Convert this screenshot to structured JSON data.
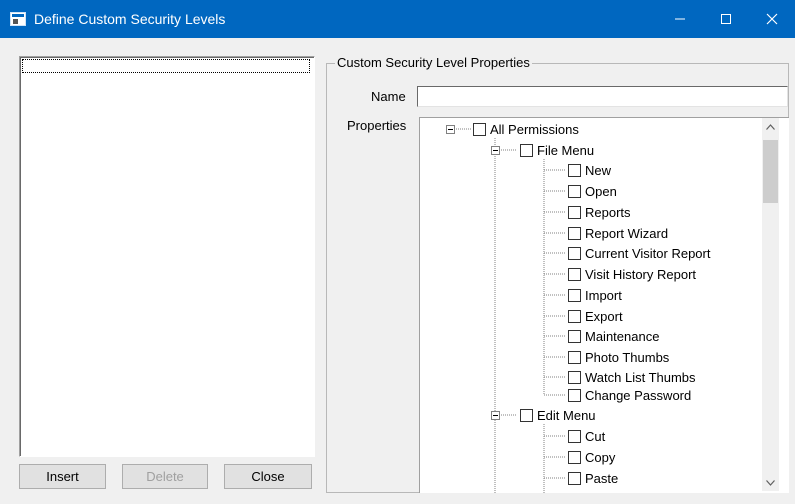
{
  "window": {
    "title": "Define Custom Security Levels"
  },
  "left_panel": {
    "buttons": {
      "insert": "Insert",
      "delete": "Delete",
      "close": "Close"
    }
  },
  "properties_group": {
    "label": "Custom Security Level Properties",
    "name_label": "Name",
    "name_value": "",
    "properties_label": "Properties"
  },
  "tree": {
    "root": "All Permissions",
    "file_menu": {
      "label": "File Menu",
      "items": [
        "New",
        "Open",
        "Reports",
        "Report Wizard",
        "Current Visitor Report",
        "Visit History Report",
        "Import",
        "Export",
        "Maintenance",
        "Photo Thumbs",
        "Watch List Thumbs",
        "Change Password"
      ]
    },
    "edit_menu": {
      "label": "Edit Menu",
      "items": [
        "Cut",
        "Copy",
        "Paste"
      ]
    }
  },
  "colors": {
    "titlebar": "#0067c0",
    "disabled_text": "#a0a0a0"
  }
}
